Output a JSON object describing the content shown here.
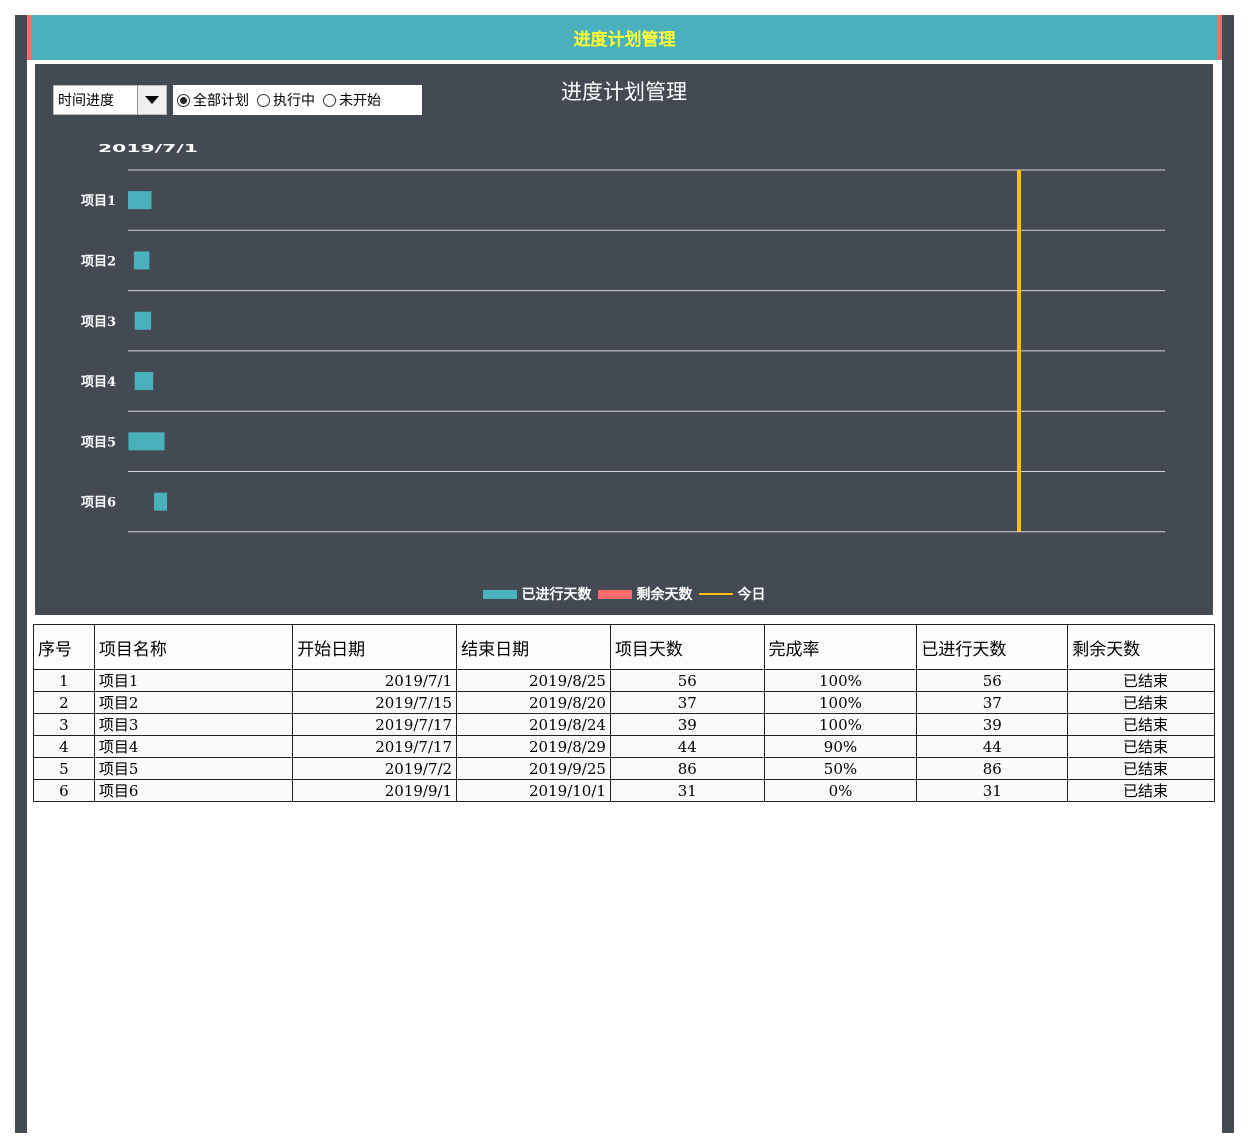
{
  "header": {
    "title": "进度计划管理"
  },
  "controls": {
    "dropdown_value": "时间进度",
    "radios": [
      {
        "label": "全部计划",
        "checked": true
      },
      {
        "label": "执行中",
        "checked": false
      },
      {
        "label": "未开始",
        "checked": false
      }
    ]
  },
  "chart_data": {
    "type": "bar",
    "title": "进度计划管理",
    "orientation": "horizontal-gantt",
    "categories": [
      "项目1",
      "项目2",
      "项目3",
      "项目4",
      "项目5",
      "项目6"
    ],
    "x_axis_label_overlapping": "2019/7/1",
    "series": [
      {
        "name": "已进行天数",
        "color": "#4ab0bb",
        "start": [
          "2019/7/1",
          "2019/7/15",
          "2019/7/17",
          "2019/7/17",
          "2019/7/2",
          "2019/9/1"
        ],
        "values": [
          56,
          37,
          39,
          44,
          86,
          31
        ]
      },
      {
        "name": "剩余天数",
        "color": "#ff6b6b",
        "values": [
          0,
          0,
          0,
          0,
          0,
          0
        ]
      }
    ],
    "today_marker": {
      "name": "今日",
      "color": "#ffc000"
    },
    "legend": "bottom-center",
    "grid": true
  },
  "table": {
    "headers": [
      "序号",
      "项目名称",
      "开始日期",
      "结束日期",
      "项目天数",
      "完成率",
      "已进行天数",
      "剩余天数"
    ],
    "rows": [
      [
        "1",
        "项目1",
        "2019/7/1",
        "2019/8/25",
        "56",
        "100%",
        "56",
        "已结束"
      ],
      [
        "2",
        "项目2",
        "2019/7/15",
        "2019/8/20",
        "37",
        "100%",
        "37",
        "已结束"
      ],
      [
        "3",
        "项目3",
        "2019/7/17",
        "2019/8/24",
        "39",
        "100%",
        "39",
        "已结束"
      ],
      [
        "4",
        "项目4",
        "2019/7/17",
        "2019/8/29",
        "44",
        "90%",
        "44",
        "已结束"
      ],
      [
        "5",
        "项目5",
        "2019/7/2",
        "2019/9/25",
        "86",
        "50%",
        "86",
        "已结束"
      ],
      [
        "6",
        "项目6",
        "2019/9/1",
        "2019/10/1",
        "31",
        "0%",
        "31",
        "已结束"
      ]
    ]
  }
}
